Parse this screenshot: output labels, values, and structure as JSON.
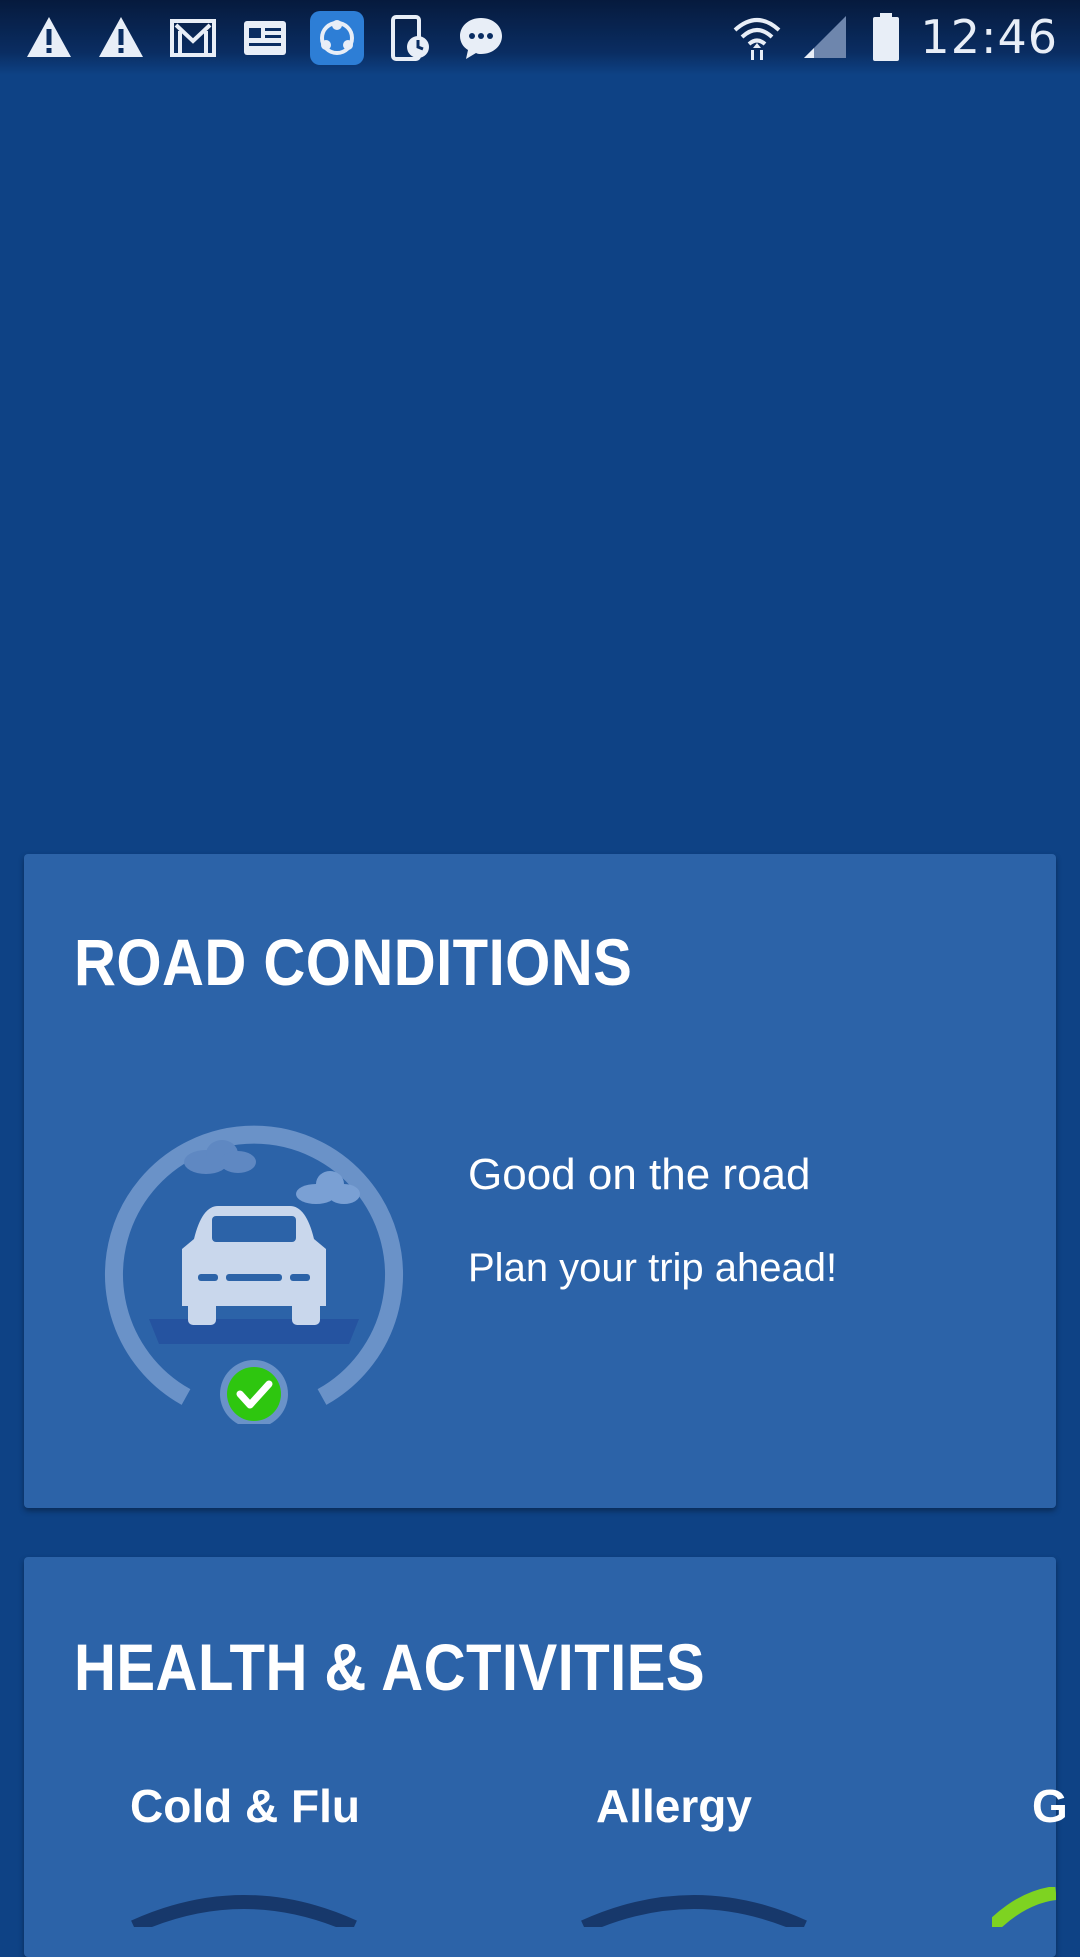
{
  "status_bar": {
    "left_icons": [
      "warning-icon",
      "warning-icon",
      "gmail-icon",
      "news-icon",
      "share-app-icon",
      "device-clock-icon",
      "chat-bubble-icon"
    ],
    "right_icons": [
      "wifi-icon",
      "signal-icon",
      "battery-icon"
    ],
    "time": "12:46"
  },
  "road_conditions": {
    "title": "ROAD CONDITIONS",
    "status": "Good on the road",
    "subtitle": "Plan your trip ahead!",
    "status_icon": "check-icon",
    "status_color": "#2ec60f"
  },
  "health_activities": {
    "title": "HEALTH & ACTIVITIES",
    "items": [
      {
        "label": "Cold & Flu"
      },
      {
        "label": "Allergy"
      },
      {
        "label": "G"
      }
    ]
  },
  "colors": {
    "background": "#0e4285",
    "card": "#2c63a8",
    "accent_green": "#7ed321"
  }
}
